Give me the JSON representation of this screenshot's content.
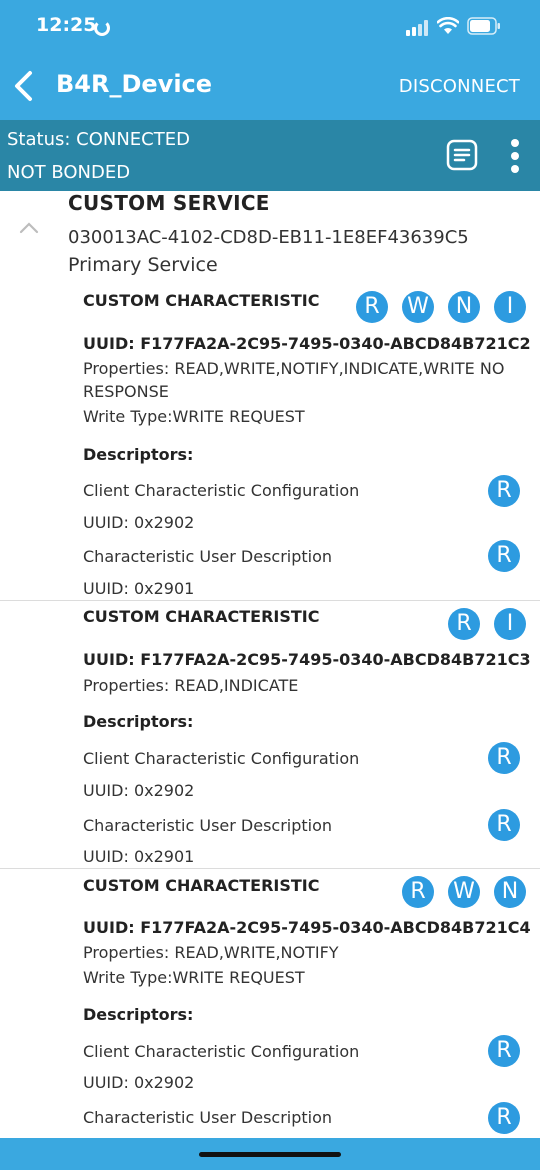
{
  "status_bar": {
    "time": "12:25"
  },
  "app_bar": {
    "title": "B4R_Device",
    "action": "DISCONNECT"
  },
  "connection": {
    "status": "Status: CONNECTED",
    "bond": "NOT BONDED"
  },
  "service": {
    "name": "CUSTOM SERVICE",
    "uuid": "030013AC-4102-CD8D-EB11-1E8EF43639C5",
    "type": "Primary Service"
  },
  "characteristics": [
    {
      "name": "CUSTOM CHARACTERISTIC",
      "badges": [
        "R",
        "W",
        "N",
        "I"
      ],
      "uuid": "UUID: F177FA2A-2C95-7495-0340-ABCD84B721C2",
      "properties_line1": "Properties: READ,WRITE,NOTIFY,INDICATE,WRITE NO",
      "properties_line2": "RESPONSE",
      "write_type": "Write Type:WRITE REQUEST",
      "descriptors_label": "Descriptors:",
      "descriptors": [
        {
          "name": "Client Characteristic Configuration",
          "uuid": "UUID: 0x2902",
          "badge": "R"
        },
        {
          "name": "Characteristic User Description",
          "uuid": "UUID: 0x2901",
          "badge": "R"
        }
      ]
    },
    {
      "name": "CUSTOM CHARACTERISTIC",
      "badges": [
        "R",
        "I"
      ],
      "uuid": "UUID: F177FA2A-2C95-7495-0340-ABCD84B721C3",
      "properties_line1": "Properties: READ,INDICATE",
      "descriptors_label": "Descriptors:",
      "descriptors": [
        {
          "name": "Client Characteristic Configuration",
          "uuid": "UUID: 0x2902",
          "badge": "R"
        },
        {
          "name": "Characteristic User Description",
          "uuid": "UUID: 0x2901",
          "badge": "R"
        }
      ]
    },
    {
      "name": "CUSTOM CHARACTERISTIC",
      "badges": [
        "R",
        "W",
        "N"
      ],
      "uuid": "UUID: F177FA2A-2C95-7495-0340-ABCD84B721C4",
      "properties_line1": "Properties: READ,WRITE,NOTIFY",
      "write_type": "Write Type:WRITE REQUEST",
      "descriptors_label": "Descriptors:",
      "descriptors": [
        {
          "name": "Client Characteristic Configuration",
          "uuid": "UUID: 0x2902",
          "badge": "R"
        },
        {
          "name": "Characteristic User Description",
          "badge": "R"
        }
      ]
    }
  ],
  "colors": {
    "primary": "#3aa8e0",
    "status_bg": "#2a86a6",
    "badge": "#2d9be0"
  }
}
